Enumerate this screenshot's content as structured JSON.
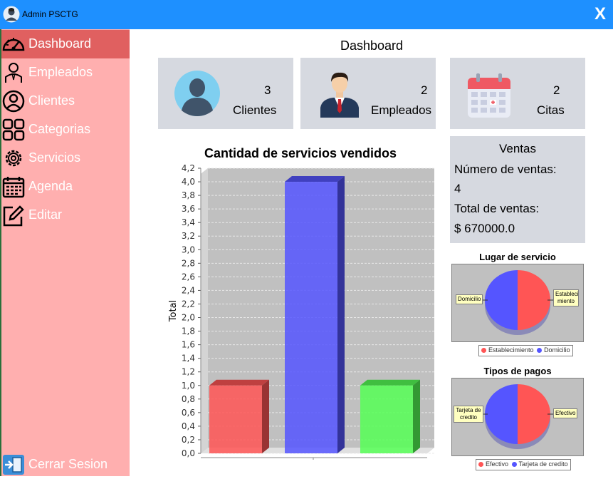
{
  "window": {
    "title": "Admin PSCTG",
    "close_label": "X"
  },
  "sidebar": {
    "items": [
      {
        "label": "Dashboard",
        "icon": "speedometer-icon",
        "active": true
      },
      {
        "label": "Empleados",
        "icon": "employee-icon",
        "active": false
      },
      {
        "label": "Clientes",
        "icon": "user-icon",
        "active": false
      },
      {
        "label": "Categorias",
        "icon": "categories-icon",
        "active": false
      },
      {
        "label": "Servicios",
        "icon": "gear-icon",
        "active": false
      },
      {
        "label": "Agenda",
        "icon": "calendar-icon",
        "active": false
      },
      {
        "label": "Editar",
        "icon": "edit-icon",
        "active": false
      }
    ],
    "logout_label": "Cerrar Sesion"
  },
  "main": {
    "title": "Dashboard"
  },
  "cards": [
    {
      "count": "3",
      "label": "Clientes",
      "icon": "client-avatar-icon"
    },
    {
      "count": "2",
      "label": "Empleados",
      "icon": "businessman-icon"
    },
    {
      "count": "2",
      "label": "Citas",
      "icon": "calendar-icon"
    }
  ],
  "ventas": {
    "title": "Ventas",
    "count_label": "Número de ventas:",
    "count": "4",
    "total_label": "Total de ventas:",
    "total": "$ 670000.0"
  },
  "colors": {
    "titlebar": "#1e90ff",
    "sidebar": "#ffafaf",
    "sidebar_active": "#e06060",
    "card": "#d6d9e0",
    "red": "#ff5555",
    "blue": "#5555ff",
    "green": "#55ff55"
  },
  "chart_data": [
    {
      "type": "bar",
      "title": "Cantidad de servicios vendidos",
      "ylabel": "Total",
      "xlabel": "",
      "categories": [
        "",
        "",
        ""
      ],
      "values": [
        1,
        4,
        1
      ],
      "colors": [
        "#ff5555",
        "#5555ff",
        "#55ff55"
      ],
      "ylim": [
        0,
        4.2
      ],
      "yticks": [
        "0,0",
        "0,2",
        "0,4",
        "0,6",
        "0,8",
        "1,0",
        "1,2",
        "1,4",
        "1,6",
        "1,8",
        "2,0",
        "2,2",
        "2,4",
        "2,6",
        "2,8",
        "3,0",
        "3,2",
        "3,4",
        "3,6",
        "3,8",
        "4,0",
        "4,2"
      ],
      "grid": true
    },
    {
      "type": "pie",
      "title": "Lugar de servicio",
      "slices": [
        {
          "name": "Establecimiento",
          "value": 50,
          "label": "Estableci miento",
          "color": "#ff5555"
        },
        {
          "name": "Domicilio",
          "value": 50,
          "label": "Domicilio",
          "color": "#5555ff"
        }
      ],
      "legend": "bottom"
    },
    {
      "type": "pie",
      "title": "Tipos de pagos",
      "slices": [
        {
          "name": "Efectivo",
          "value": 50,
          "label": "Efectivo",
          "color": "#ff5555"
        },
        {
          "name": "Tarjeta de credito",
          "value": 50,
          "label": "Tarjeta de credito",
          "color": "#5555ff"
        }
      ],
      "legend": "bottom"
    }
  ]
}
